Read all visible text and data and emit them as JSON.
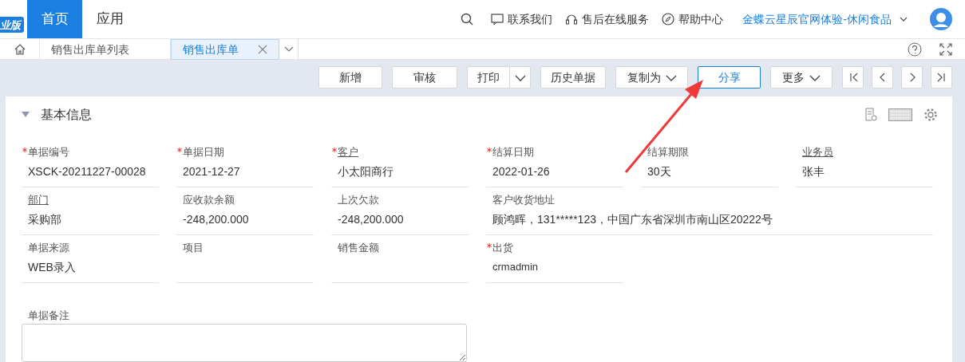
{
  "header": {
    "logo": "业版",
    "nav": [
      {
        "label": "首页",
        "selected": true
      },
      {
        "label": "应用",
        "selected": false
      }
    ],
    "links": [
      {
        "kind": "chat",
        "label": "联系我们"
      },
      {
        "kind": "headset",
        "label": "售后在线服务"
      },
      {
        "kind": "compass",
        "label": "帮助中心"
      }
    ],
    "account": "金蝶云星辰官网体验-休闲食品"
  },
  "tabs": [
    {
      "label": "销售出库单列表",
      "selected": false,
      "closable": false
    },
    {
      "label": "销售出库单",
      "selected": true,
      "closable": true
    }
  ],
  "toolbar": [
    {
      "label": "新增",
      "kind": "plain",
      "selected": false
    },
    {
      "label": "审核",
      "kind": "plain",
      "selected": false
    },
    {
      "label": "打印",
      "kind": "split",
      "selected": false
    },
    {
      "label": "历史单据",
      "kind": "plain",
      "selected": false
    },
    {
      "label": "复制为",
      "kind": "dropdown",
      "selected": false
    },
    {
      "label": "分享",
      "kind": "plain",
      "selected": true
    },
    {
      "label": "更多",
      "kind": "dropdown",
      "selected": false
    }
  ],
  "section": {
    "title": "基本信息",
    "expanded": true,
    "fields": [
      {
        "label": "单据编号",
        "value": "XSCK-20211227-00028",
        "required": true,
        "link": false
      },
      {
        "label": "单据日期",
        "value": "2021-12-27",
        "required": true,
        "link": false
      },
      {
        "label": "客户",
        "value": "小太阳商行",
        "required": true,
        "link": true
      },
      {
        "label": "结算日期",
        "value": "2022-01-26",
        "required": true,
        "link": false
      },
      {
        "label": "结算期限",
        "value": "30天",
        "required": false,
        "link": false
      },
      {
        "label": "业务员",
        "value": "张丰",
        "required": false,
        "link": true
      },
      {
        "label": "部门",
        "value": "采购部",
        "required": false,
        "link": true
      },
      {
        "label": "应收款余额",
        "value": "-248,200.000",
        "required": false,
        "link": false
      },
      {
        "label": "上次欠款",
        "value": "-248,200.000",
        "required": false,
        "link": false
      },
      {
        "label": "客户收货地址",
        "value": "顾鸿晖，131*****123，中国广东省深圳市南山区20222号",
        "required": false,
        "link": false,
        "wide": true
      },
      {
        "label": "单据来源",
        "value": "WEB录入",
        "required": false,
        "link": false
      },
      {
        "label": "项目",
        "required": false,
        "link": false
      },
      {
        "label": "销售金额",
        "required": false,
        "link": false
      },
      {
        "label": "出货",
        "value": "crmadmin",
        "required": true,
        "link": false,
        "small": true
      }
    ],
    "remarks": {
      "label": "单据备注"
    }
  }
}
